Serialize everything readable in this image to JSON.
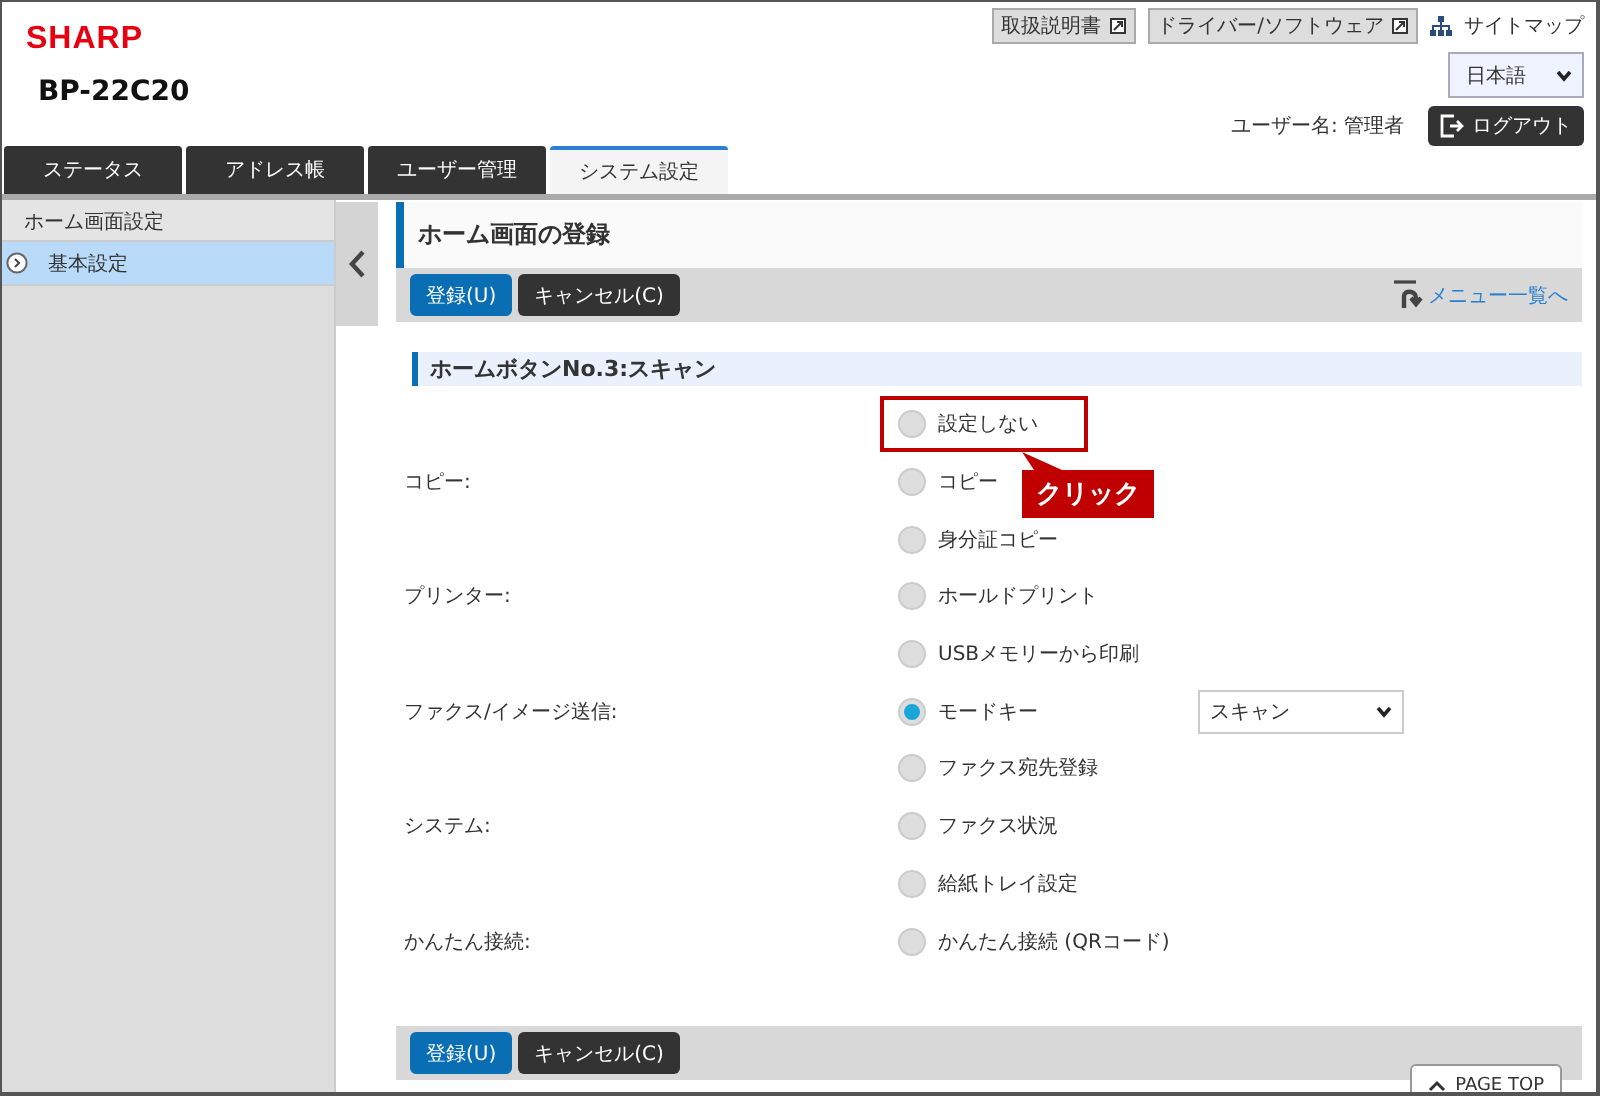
{
  "header": {
    "logo": "SHARP",
    "model": "BP-22C20",
    "links": [
      {
        "label": "取扱説明書"
      },
      {
        "label": "ドライバー/ソフトウェア"
      }
    ],
    "sitemap": "サイトマップ",
    "language": {
      "value": "日本語"
    },
    "user": "ユーザー名: 管理者",
    "logout": "ログアウト"
  },
  "tabs": [
    {
      "label": "ステータス",
      "selected": false
    },
    {
      "label": "アドレス帳",
      "selected": false
    },
    {
      "label": "ユーザー管理",
      "selected": false
    },
    {
      "label": "システム設定",
      "selected": true
    }
  ],
  "sidebar": {
    "title": "ホーム画面設定",
    "items": [
      {
        "label": "基本設定",
        "selected": true
      }
    ]
  },
  "page": {
    "title": "ホーム画面の登録",
    "buttons": [
      {
        "label": "登録(U)",
        "kind": "primary"
      },
      {
        "label": "キャンセル(C)",
        "kind": "secondary"
      }
    ],
    "menu_link": "メニュー一覧へ",
    "section": "ホームボタンNo.3:スキャン",
    "groups": [
      {
        "options": [
          {
            "label": "設定しない",
            "selected": false,
            "callout": "クリック"
          }
        ]
      },
      {
        "label": "コピー:",
        "options": [
          {
            "label": "コピー",
            "selected": false
          },
          {
            "label": "身分証コピー",
            "selected": false
          }
        ]
      },
      {
        "label": "プリンター:",
        "options": [
          {
            "label": "ホールドプリント",
            "selected": false
          },
          {
            "label": "USBメモリーから印刷",
            "selected": false
          }
        ]
      },
      {
        "label": "ファクス/イメージ送信:",
        "options": [
          {
            "label": "モードキー",
            "selected": true,
            "select": {
              "value": "スキャン"
            }
          },
          {
            "label": "ファクス宛先登録",
            "selected": false
          }
        ]
      },
      {
        "label": "システム:",
        "options": [
          {
            "label": "ファクス状況",
            "selected": false
          },
          {
            "label": "給紙トレイ設定",
            "selected": false
          }
        ]
      },
      {
        "label": "かんたん接続:",
        "options": [
          {
            "label": "かんたん接続 (QRコード)",
            "selected": false
          }
        ]
      }
    ],
    "bottom_buttons": [
      {
        "label": "登録(U)",
        "kind": "primary"
      },
      {
        "label": "キャンセル(C)",
        "kind": "secondary"
      }
    ],
    "page_top": "PAGE TOP"
  }
}
